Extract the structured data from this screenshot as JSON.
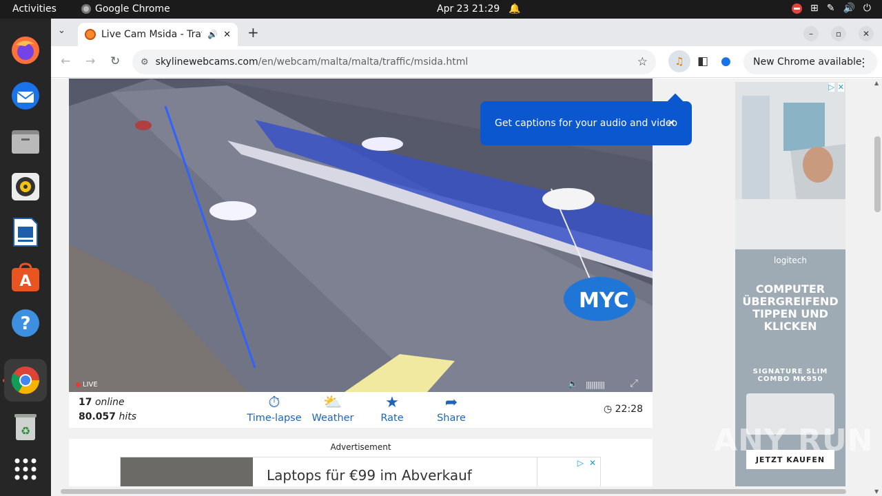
{
  "topbar": {
    "activities": "Activities",
    "app_name": "Google Chrome",
    "datetime": "Apr 23  21:29"
  },
  "dock": {
    "items": [
      "firefox",
      "thunderbird",
      "files",
      "rhythmbox",
      "libreoffice-impress",
      "app-center",
      "help",
      "chrome",
      "trash",
      "show-apps"
    ]
  },
  "browser": {
    "tab_title": "Live Cam Msida - Traffi",
    "url_domain": "skylinewebcams.com",
    "url_path": "/en/webcam/malta/malta/traffic/msida.html",
    "new_chrome": "New Chrome available",
    "captions_popup": "Get captions for your audio and video"
  },
  "webcam": {
    "live_label": "LIVE",
    "logo_text": "MYC",
    "online_count": "17",
    "online_label": "online",
    "hits_count": "80.057",
    "hits_label": "hits",
    "controls": [
      {
        "icon": "timelapse-icon",
        "label": "Time-lapse"
      },
      {
        "icon": "weather-icon",
        "label": "Weather"
      },
      {
        "icon": "star-icon",
        "label": "Rate"
      },
      {
        "icon": "share-icon",
        "label": "Share"
      }
    ],
    "local_time": "22:28"
  },
  "ads": {
    "label": "Advertisement",
    "banner_text": "Laptops für €99 im Abverkauf",
    "side_brand": "logitech",
    "side_headline": "COMPUTER ÜBERGREIFEND TIPPEN UND KLICKEN",
    "side_product": "SIGNATURE SLIM COMBO MK950",
    "side_cta": "JETZT KAUFEN"
  },
  "watermark": "ANY RUN",
  "colors": {
    "accent": "#0b57d0",
    "link_blue": "#1e64b8",
    "live_red": "#e53935"
  }
}
